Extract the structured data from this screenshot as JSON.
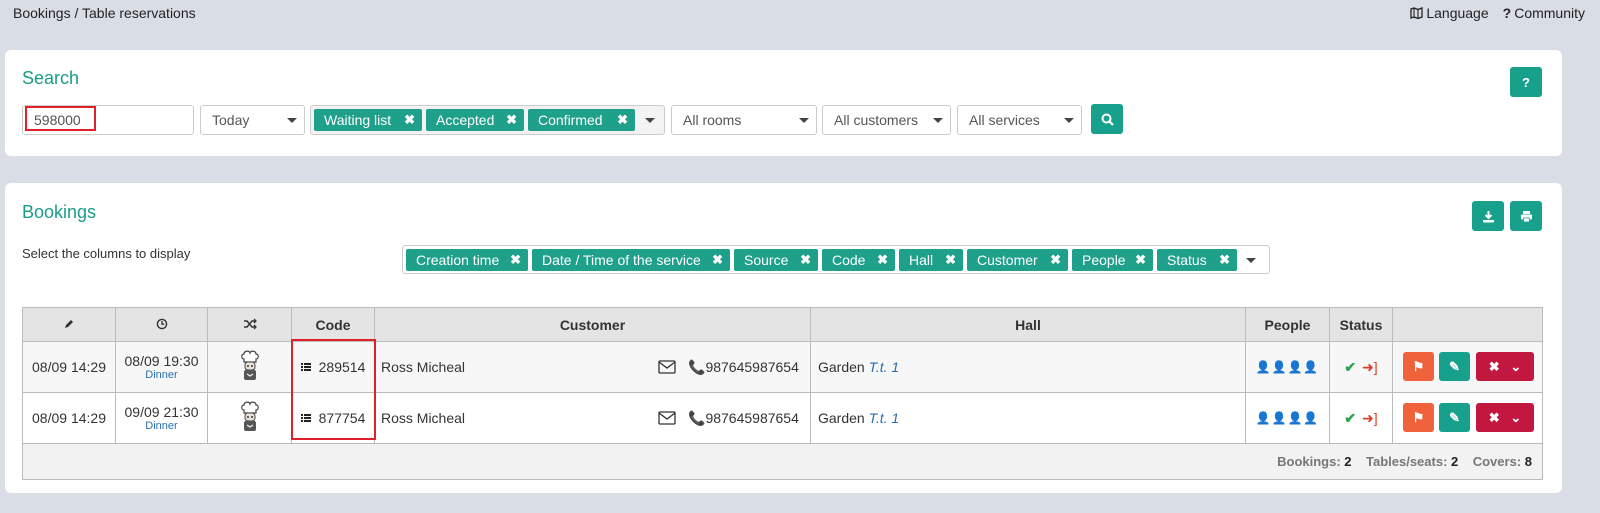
{
  "breadcrumb": "Bookings / Table reservations",
  "top_links": {
    "language": "Language",
    "community": "Community",
    "language_icon": "language-map-icon",
    "community_icon": "question-icon"
  },
  "search": {
    "title": "Search",
    "help_label": "?",
    "query": "598000",
    "date": "Today",
    "statuses": [
      "Waiting list",
      "Accepted",
      "Confirmed"
    ],
    "rooms": "All rooms",
    "customers": "All customers",
    "services": "All services",
    "search_icon": "search-icon"
  },
  "bookings": {
    "title": "Bookings",
    "columns_label": "Select the columns to display",
    "columns": [
      "Creation time",
      "Date / Time of the service",
      "Source",
      "Code",
      "Hall",
      "Customer",
      "People",
      "Status"
    ],
    "headers": {
      "code": "Code",
      "customer": "Customer",
      "hall": "Hall",
      "people": "People",
      "status": "Status"
    },
    "rows": [
      {
        "created": "08/09 14:29",
        "service_time": "08/09 19:30",
        "service": "Dinner",
        "code": "289514",
        "customer": "Ross Micheal",
        "phone": "987645987654",
        "hall": "Garden",
        "table": "T.t. 1"
      },
      {
        "created": "08/09 14:29",
        "service_time": "09/09 21:30",
        "service": "Dinner",
        "code": "877754",
        "customer": "Ross Micheal",
        "phone": "987645987654",
        "hall": "Garden",
        "table": "T.t. 1"
      }
    ],
    "totals": {
      "bookings_label": "Bookings:",
      "bookings": "2",
      "tables_label": "Tables/seats:",
      "tables": "2",
      "covers_label": "Covers:",
      "covers": "8"
    }
  },
  "colors": {
    "accent": "#17a08c",
    "flag": "#f0623a",
    "delete": "#c2183f",
    "highlight": "#e0202a"
  }
}
